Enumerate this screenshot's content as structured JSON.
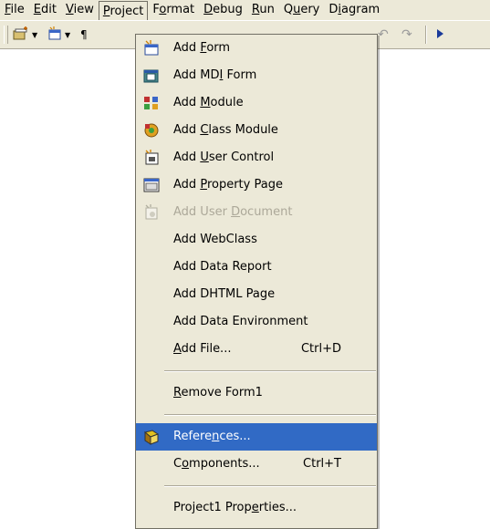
{
  "menubar": {
    "items": [
      {
        "pre": "",
        "key": "F",
        "post": "ile"
      },
      {
        "pre": "",
        "key": "E",
        "post": "dit"
      },
      {
        "pre": "",
        "key": "V",
        "post": "iew"
      },
      {
        "pre": "",
        "key": "P",
        "post": "roject"
      },
      {
        "pre": "F",
        "key": "o",
        "post": "rmat"
      },
      {
        "pre": "",
        "key": "D",
        "post": "ebug"
      },
      {
        "pre": "",
        "key": "R",
        "post": "un"
      },
      {
        "pre": "Q",
        "key": "u",
        "post": "ery"
      },
      {
        "pre": "D",
        "key": "i",
        "post": "agram"
      }
    ]
  },
  "toolbar": {
    "icons": [
      "add-project-icon",
      "add-form-icon",
      "undo-icon",
      "redo-icon",
      "run-icon"
    ]
  },
  "menu": {
    "items": [
      {
        "pre": "Add ",
        "key": "F",
        "post": "orm",
        "shortcut": ""
      },
      {
        "pre": "Add MD",
        "key": "I",
        "post": " Form",
        "shortcut": ""
      },
      {
        "pre": "Add ",
        "key": "M",
        "post": "odule",
        "shortcut": ""
      },
      {
        "pre": "Add ",
        "key": "C",
        "post": "lass Module",
        "shortcut": ""
      },
      {
        "pre": "Add ",
        "key": "U",
        "post": "ser Control",
        "shortcut": ""
      },
      {
        "pre": "Add ",
        "key": "P",
        "post": "roperty Page",
        "shortcut": ""
      },
      {
        "pre": "Add User ",
        "key": "D",
        "post": "ocument",
        "shortcut": ""
      },
      {
        "pre": "Add WebClass",
        "key": "",
        "post": "",
        "shortcut": ""
      },
      {
        "pre": "Add Data Report",
        "key": "",
        "post": "",
        "shortcut": ""
      },
      {
        "pre": "Add DHTML Page",
        "key": "",
        "post": "",
        "shortcut": ""
      },
      {
        "pre": "Add Data Environment",
        "key": "",
        "post": "",
        "shortcut": ""
      },
      {
        "pre": "",
        "key": "A",
        "post": "dd File...",
        "shortcut": "Ctrl+D"
      },
      {
        "pre": "",
        "key": "R",
        "post": "emove Form1",
        "shortcut": ""
      },
      {
        "pre": "Refere",
        "key": "n",
        "post": "ces...",
        "shortcut": ""
      },
      {
        "pre": "C",
        "key": "o",
        "post": "mponents...",
        "shortcut": "Ctrl+T"
      },
      {
        "pre": "Project1 Prop",
        "key": "e",
        "post": "rties...",
        "shortcut": ""
      }
    ]
  },
  "colors": {
    "menu_bg": "#ece9d8",
    "selection": "#316ac5",
    "disabled_text": "#aca899"
  }
}
